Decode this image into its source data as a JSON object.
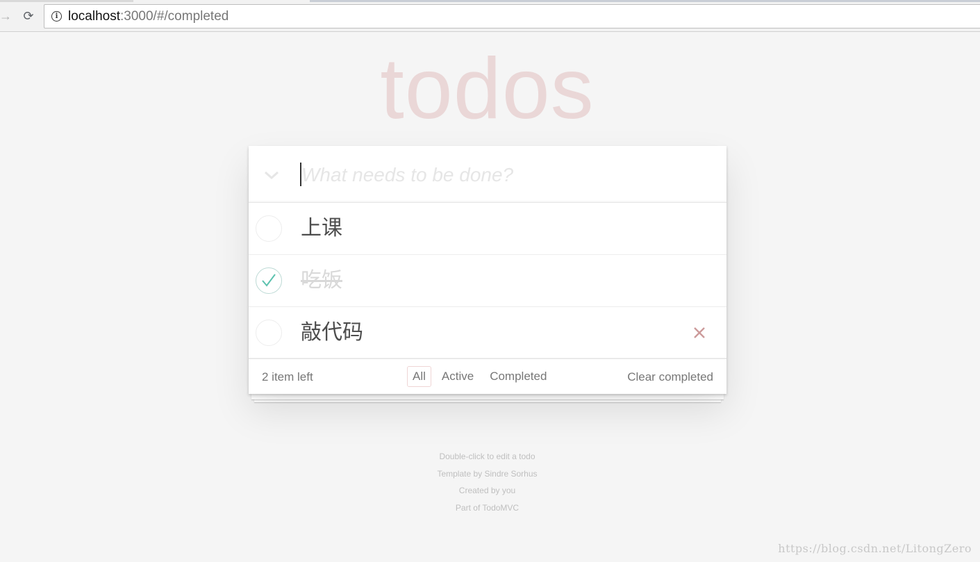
{
  "browser": {
    "url_host": "localhost",
    "url_path": ":3000/#/completed",
    "reload_glyph": "⟳",
    "forward_glyph": "→",
    "info_glyph": "i"
  },
  "app": {
    "title": "todos",
    "new_todo_placeholder": "What needs to be done?",
    "toggle_all_icon": "chevron-down-icon"
  },
  "todos": [
    {
      "label": "上课",
      "completed": false,
      "show_destroy": false
    },
    {
      "label": "吃饭",
      "completed": true,
      "show_destroy": false
    },
    {
      "label": "敲代码",
      "completed": false,
      "show_destroy": true
    }
  ],
  "footer": {
    "count_text": "2 item left",
    "filters": [
      {
        "label": "All",
        "selected": true
      },
      {
        "label": "Active",
        "selected": false
      },
      {
        "label": "Completed",
        "selected": false
      }
    ],
    "clear_completed": "Clear completed"
  },
  "info": {
    "line1": "Double-click to edit a todo",
    "line2": "Template by Sindre Sorhus",
    "line3": "Created by you",
    "line4": "Part of TodoMVC"
  },
  "watermark": "https://blog.csdn.net/LitongZero",
  "colors": {
    "check_accent": "#5dc2af",
    "destroy": "#cc9a9a",
    "title": "rgba(175,47,47,0.15)"
  }
}
